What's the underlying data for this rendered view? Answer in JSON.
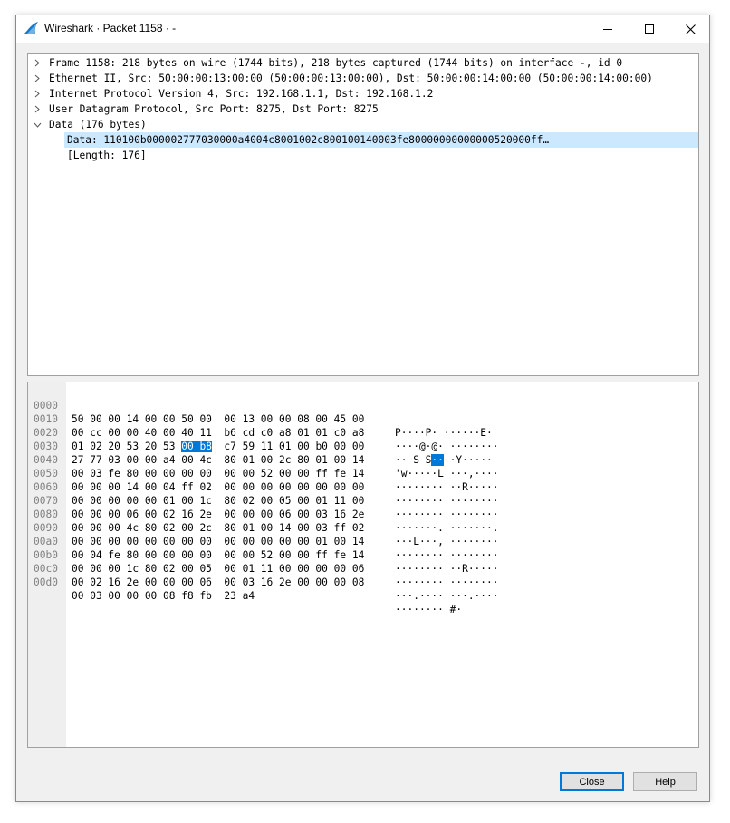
{
  "window": {
    "title": "Wireshark · Packet 1158 · -",
    "icon": "wireshark-fin-icon",
    "controls": [
      "minimize-icon",
      "maximize-icon",
      "close-icon"
    ]
  },
  "tree": [
    {
      "expanded": false,
      "text": "Frame 1158: 218 bytes on wire (1744 bits), 218 bytes captured (1744 bits) on interface -, id 0"
    },
    {
      "expanded": false,
      "text": "Ethernet II, Src: 50:00:00:13:00:00 (50:00:00:13:00:00), Dst: 50:00:00:14:00:00 (50:00:00:14:00:00)"
    },
    {
      "expanded": false,
      "text": "Internet Protocol Version 4, Src: 192.168.1.1, Dst: 192.168.1.2"
    },
    {
      "expanded": false,
      "text": "User Datagram Protocol, Src Port: 8275, Dst Port: 8275"
    },
    {
      "expanded": true,
      "text": "Data (176 bytes)"
    },
    {
      "child": true,
      "selected": true,
      "text": "Data: 110100b000002777030000a4004c8001002c800100140003fe80000000000000520000ff…"
    },
    {
      "child": true,
      "text": "[Length: 176]"
    }
  ],
  "hex": [
    {
      "offset": "0000",
      "bytes": "50 00 00 14 00 00 50 00  00 13 00 00 08 00 45 00",
      "ascii": "P····P· ······E·"
    },
    {
      "offset": "0010",
      "bytes": "00 cc 00 00 40 00 40 11  b6 cd c0 a8 01 01 c0 a8",
      "ascii": "····@·@· ········"
    },
    {
      "offset": "0020",
      "bytes_pre": "01 02 20 53 20 53 ",
      "bytes_hl": "00 b8",
      "bytes_post": "  c7 59 11 01 00 b0 00 00",
      "ascii_pre": "·· S S",
      "ascii_hl": "··",
      "ascii_post": " ·Y·····"
    },
    {
      "offset": "0030",
      "bytes": "27 77 03 00 00 a4 00 4c  80 01 00 2c 80 01 00 14",
      "ascii": "'w·····L ···,····"
    },
    {
      "offset": "0040",
      "bytes": "00 03 fe 80 00 00 00 00  00 00 52 00 00 ff fe 14",
      "ascii": "········ ··R·····"
    },
    {
      "offset": "0050",
      "bytes": "00 00 00 14 00 04 ff 02  00 00 00 00 00 00 00 00",
      "ascii": "········ ········"
    },
    {
      "offset": "0060",
      "bytes": "00 00 00 00 00 01 00 1c  80 02 00 05 00 01 11 00",
      "ascii": "········ ········"
    },
    {
      "offset": "0070",
      "bytes": "00 00 00 06 00 02 16 2e  00 00 00 06 00 03 16 2e",
      "ascii": "·······. ·······."
    },
    {
      "offset": "0080",
      "bytes": "00 00 00 4c 80 02 00 2c  80 01 00 14 00 03 ff 02",
      "ascii": "···L···, ········"
    },
    {
      "offset": "0090",
      "bytes": "00 00 00 00 00 00 00 00  00 00 00 00 00 01 00 14",
      "ascii": "········ ········"
    },
    {
      "offset": "00a0",
      "bytes": "00 04 fe 80 00 00 00 00  00 00 52 00 00 ff fe 14",
      "ascii": "········ ··R·····"
    },
    {
      "offset": "00b0",
      "bytes": "00 00 00 1c 80 02 00 05  00 01 11 00 00 00 00 06",
      "ascii": "········ ········"
    },
    {
      "offset": "00c0",
      "bytes": "00 02 16 2e 00 00 00 06  00 03 16 2e 00 00 00 08",
      "ascii": "···.···· ···.····"
    },
    {
      "offset": "00d0",
      "bytes": "00 03 00 00 00 08 f8 fb  23 a4",
      "ascii": "········ #·"
    }
  ],
  "buttons": {
    "close": "Close",
    "help": "Help"
  },
  "colors": {
    "selection": "#cce8ff",
    "highlight": "#0078d7",
    "accent": "#0078d7"
  }
}
